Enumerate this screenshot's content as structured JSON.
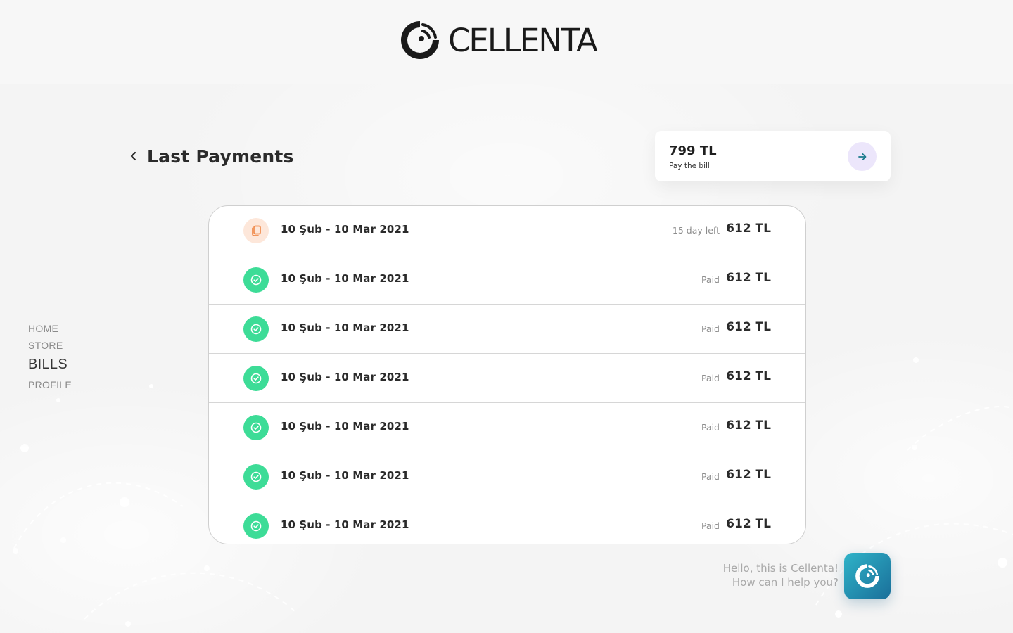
{
  "brand": {
    "name": "CELLENTA"
  },
  "nav": {
    "items": [
      {
        "label": "HOME",
        "active": false
      },
      {
        "label": "STORE",
        "active": false
      },
      {
        "label": "BILLS",
        "active": true
      },
      {
        "label": "PROFILE",
        "active": false
      }
    ]
  },
  "page": {
    "title": "Last Payments"
  },
  "pay_card": {
    "amount": "799 TL",
    "label": "Pay the bill"
  },
  "bills": [
    {
      "period": "10 Şub - 10 Mar 2021",
      "status": "15 day left",
      "amount": "612 TL",
      "state": "pending"
    },
    {
      "period": "10 Şub - 10 Mar 2021",
      "status": "Paid",
      "amount": "612 TL",
      "state": "paid"
    },
    {
      "period": "10 Şub - 10 Mar 2021",
      "status": "Paid",
      "amount": "612 TL",
      "state": "paid"
    },
    {
      "period": "10 Şub - 10 Mar 2021",
      "status": "Paid",
      "amount": "612 TL",
      "state": "paid"
    },
    {
      "period": "10 Şub - 10 Mar 2021",
      "status": "Paid",
      "amount": "612 TL",
      "state": "paid"
    },
    {
      "period": "10 Şub - 10 Mar 2021",
      "status": "Paid",
      "amount": "612 TL",
      "state": "paid"
    },
    {
      "period": "10 Şub - 10 Mar 2021",
      "status": "Paid",
      "amount": "612 TL",
      "state": "paid"
    }
  ],
  "chat": {
    "line1": "Hello, this is Cellenta!",
    "line2": "How can I help you?"
  },
  "colors": {
    "paid": "#3ddc97",
    "pending_bg": "#fde7da",
    "pending_icon": "#f08a4b",
    "arrow_bg": "#ece6fb",
    "arrow_icon": "#1b7a8c",
    "chat_gradient_start": "#2fb3c8",
    "chat_gradient_end": "#1a6f9a"
  },
  "icons": {
    "back": "chevron-left-icon",
    "arrow": "arrow-right-icon",
    "paid": "check-circle-icon",
    "pending": "documents-icon",
    "chat": "cellenta-logo-icon"
  }
}
